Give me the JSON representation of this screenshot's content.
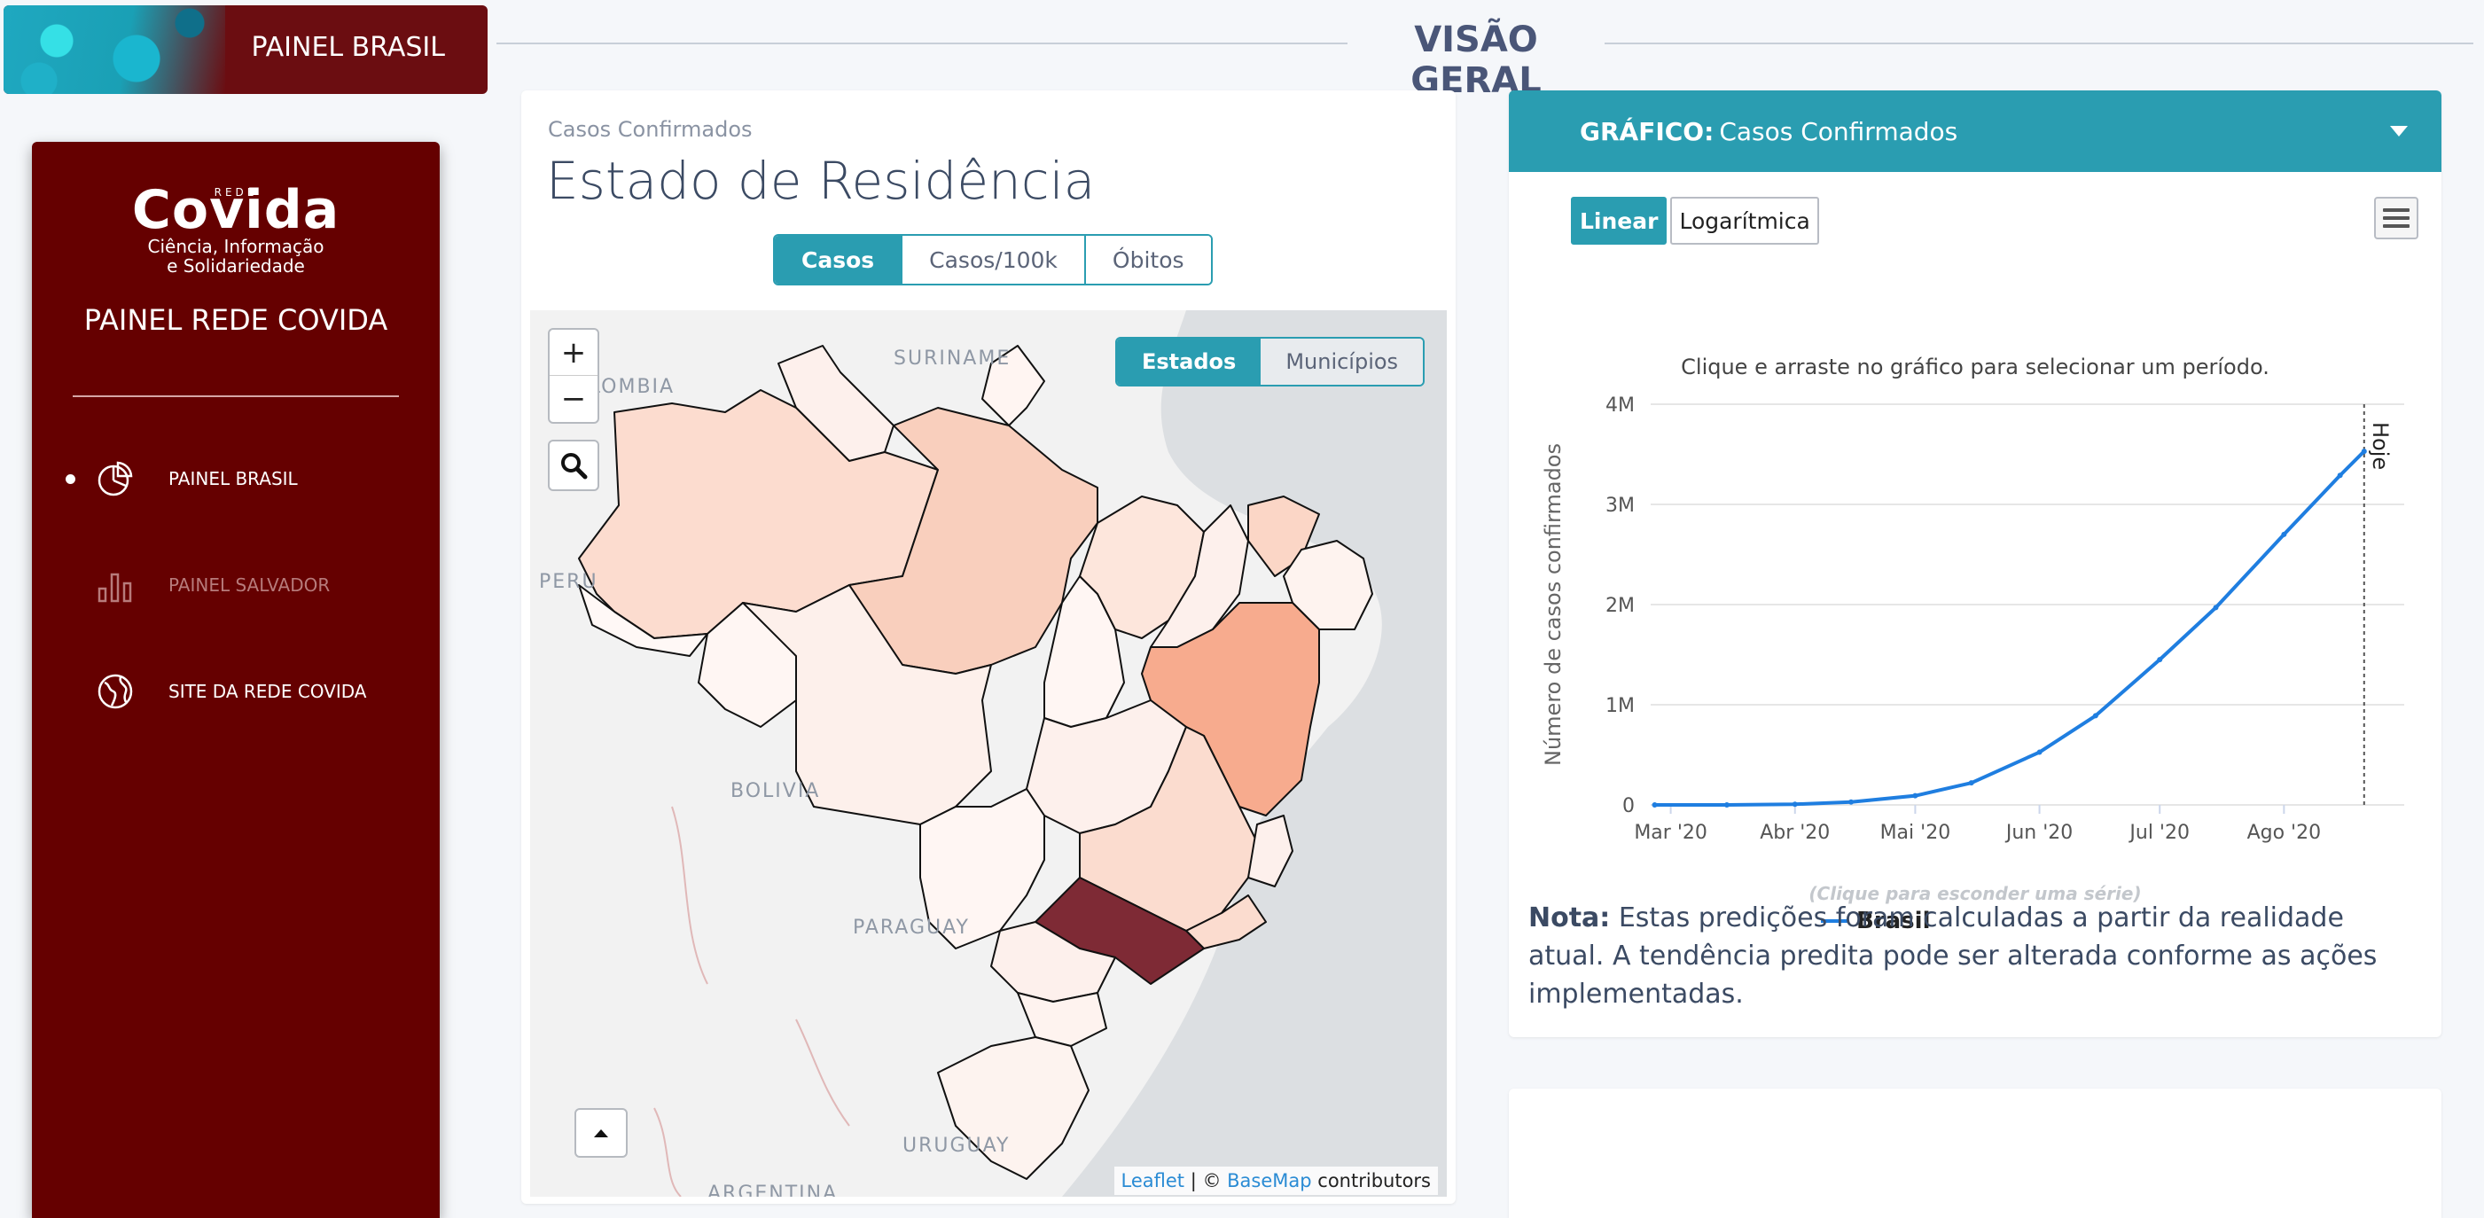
{
  "brand": {
    "label": "PAINEL BRASIL"
  },
  "header": {
    "title": "VISÃO GERAL"
  },
  "sidebar": {
    "logo_small": "REDE",
    "logo_main": "Covida",
    "logo_sub1": "Ciência, Informação",
    "logo_sub2": "e Solidariedade",
    "title": "PAINEL REDE COVIDA",
    "items": [
      {
        "label": "PAINEL BRASIL",
        "icon": "pie-chart-icon",
        "active": true
      },
      {
        "label": "PAINEL SALVADOR",
        "icon": "bar-chart-icon",
        "active": false
      },
      {
        "label": "SITE DA REDE COVIDA",
        "icon": "globe-icon",
        "active": false
      }
    ]
  },
  "map_card": {
    "subtitle": "Casos Confirmados",
    "title": "Estado de Residência",
    "metric_buttons": [
      "Casos",
      "Casos/100k",
      "Óbitos"
    ],
    "active_metric": "Casos",
    "layer_buttons": [
      "Estados",
      "Municípios"
    ],
    "active_layer": "Estados",
    "country_labels": [
      "SURINAME",
      "COLOMBIA",
      "PERU",
      "BOLIVIA",
      "PARAGUAY",
      "URUGUAY",
      "ARGENTINA"
    ],
    "zoom_in": "+",
    "zoom_out": "−",
    "attribution": {
      "leaflet": "Leaflet",
      "sep": " | © ",
      "basemap": "BaseMap",
      "suffix": " contributors"
    },
    "colors": {
      "low": "#fdf3ef",
      "mid": "#f9d2c1",
      "high": "#f7a98a",
      "max": "#7e2a35"
    }
  },
  "chart_card": {
    "header_prefix": "GRÁFICO:",
    "header_title": "Casos Confirmados",
    "scale_buttons": [
      "Linear",
      "Logarítmica"
    ],
    "active_scale": "Linear",
    "instruction": "Clique e arraste no gráfico para selecionar um período.",
    "legend_hint": "(Clique para esconder uma série)",
    "note_label": "Nota:",
    "note_text": " Estas predições foram calculadas a partir da realidade atual. A tendência predita pode ser alterada conforme as ações implementadas."
  },
  "chart_data": {
    "type": "line",
    "ylabel": "Número de casos confirmados",
    "xlabel": "",
    "y_ticks": [
      "0",
      "1M",
      "2M",
      "3M",
      "4M"
    ],
    "ylim": [
      0,
      4000000
    ],
    "x_ticks": [
      "Mar '20",
      "Abr '20",
      "Mai '20",
      "Jun '20",
      "Jul '20",
      "Ago '20"
    ],
    "x_tick_dates": [
      "2020-03-01",
      "2020-04-01",
      "2020-05-01",
      "2020-06-01",
      "2020-07-01",
      "2020-08-01"
    ],
    "xlim": [
      "2020-02-25",
      "2020-08-31"
    ],
    "today_label": "Hoje",
    "today_date": "2020-08-21",
    "series": [
      {
        "name": "Brasil",
        "color": "#1f7ee0",
        "x": [
          "2020-02-26",
          "2020-03-15",
          "2020-04-01",
          "2020-04-15",
          "2020-05-01",
          "2020-05-15",
          "2020-06-01",
          "2020-06-15",
          "2020-07-01",
          "2020-07-15",
          "2020-08-01",
          "2020-08-15",
          "2020-08-21"
        ],
        "values": [
          1,
          200,
          6900,
          28300,
          91600,
          220000,
          526000,
          890000,
          1450000,
          1970000,
          2700000,
          3290000,
          3530000
        ]
      }
    ],
    "grid": true,
    "legend": "bottom-center"
  }
}
